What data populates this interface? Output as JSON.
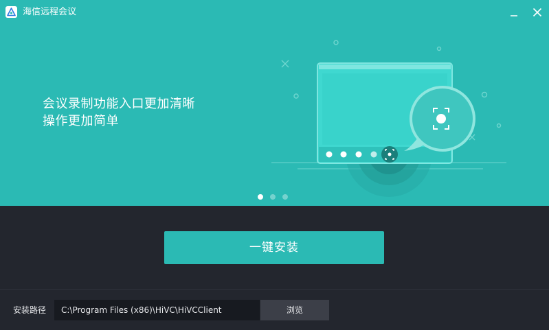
{
  "window": {
    "title": "海信远程会议"
  },
  "hero": {
    "headline_line1": "会议录制功能入口更加清晰",
    "headline_line2": "操作更加简单",
    "carousel_total": 3,
    "carousel_active": 1
  },
  "actions": {
    "install_label": "一键安装"
  },
  "install_path": {
    "label": "安装路径",
    "value": "C:\\Program Files (x86)\\HiVC\\HiVCClient",
    "browse_label": "浏览"
  },
  "colors": {
    "accent": "#2bbab4",
    "background": "#23262e",
    "input_bg": "#171a20",
    "browse_bg": "#3c3f48"
  },
  "icons": {
    "app": "app-logo-icon",
    "minimize": "minimize-icon",
    "close": "close-icon",
    "illustration": "recording-screen-illustration"
  }
}
